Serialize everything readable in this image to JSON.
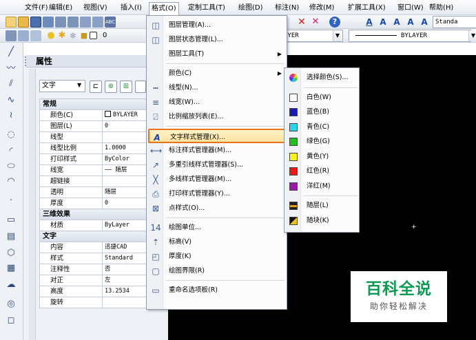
{
  "menubar": [
    "文件(F)",
    "编辑(E)",
    "视图(V)",
    "插入(I)",
    "格式(O)",
    "定制工具(T)",
    "绘图(D)",
    "标注(N)",
    "修改(M)",
    "扩展工具(X)",
    "窗口(W)",
    "帮助(H)"
  ],
  "toolbar": {
    "layer_value": "0",
    "linetype_value": "AYER",
    "lineweight_value": "BYLAYER",
    "textstyle_value": "Standa"
  },
  "properties": {
    "title": "属性",
    "filter_value": "文字",
    "rows": [
      {
        "group": true,
        "label": "常规"
      },
      {
        "label": "颜色(C)",
        "value": "BYLAYER"
      },
      {
        "label": "图层(L)",
        "value": "0"
      },
      {
        "label": "线型",
        "value": ""
      },
      {
        "label": "线型比例",
        "value": "1.0000"
      },
      {
        "label": "打印样式",
        "value": "ByColor"
      },
      {
        "label": "线宽",
        "value": "—— 随层"
      },
      {
        "label": "超链接",
        "value": ""
      },
      {
        "label": "透明",
        "value": "随层"
      },
      {
        "label": "厚度",
        "value": "0"
      },
      {
        "group": true,
        "label": "三维效果"
      },
      {
        "label": "材质",
        "value": "ByLayer"
      },
      {
        "group": true,
        "label": "文字"
      },
      {
        "label": "内容",
        "value": "迅捷CAD"
      },
      {
        "label": "样式",
        "value": "Standard"
      },
      {
        "label": "注释性",
        "value": "否"
      },
      {
        "label": "对正",
        "value": "左"
      },
      {
        "label": "高度",
        "value": "13.2534"
      },
      {
        "label": "旋转",
        "value": ""
      }
    ]
  },
  "format_menu": {
    "items": [
      {
        "label": "图层管理(A)...",
        "icon": "layer-manager-icon"
      },
      {
        "label": "图层状态管理(L)...",
        "icon": "layer-state-icon"
      },
      {
        "label": "图层工具(T)",
        "icon": "",
        "submenu": true
      },
      {
        "sep": true
      },
      {
        "label": "颜色(C)",
        "icon": "",
        "submenu": true
      },
      {
        "label": "线型(N)...",
        "icon": "linetype-icon"
      },
      {
        "label": "线宽(W)...",
        "icon": "lineweight-icon"
      },
      {
        "label": "比例缩放列表(E)...",
        "icon": "scale-list-icon"
      },
      {
        "sep": true
      },
      {
        "label": "文字样式管理(X)...",
        "icon": "text-style-icon",
        "highlight": true
      },
      {
        "label": "标注样式管理器(M)...",
        "icon": "dim-style-icon"
      },
      {
        "label": "多重引线样式管理器(S)...",
        "icon": "mleader-style-icon"
      },
      {
        "label": "多线样式管理器(M)...",
        "icon": "mline-style-icon"
      },
      {
        "label": "打印样式管理器(Y)...",
        "icon": "plot-style-icon"
      },
      {
        "label": "点样式(O)...",
        "icon": "point-style-icon"
      },
      {
        "sep": true
      },
      {
        "label": "绘图单位...",
        "icon": "units-icon"
      },
      {
        "label": "标高(V)",
        "icon": "elevation-icon"
      },
      {
        "label": "厚度(K)",
        "icon": "thickness-icon"
      },
      {
        "label": "绘图界限(R)",
        "icon": "limits-icon"
      },
      {
        "sep": true
      },
      {
        "label": "重命名选项板(R)",
        "icon": "rename-icon"
      }
    ]
  },
  "color_submenu": {
    "items": [
      {
        "label": "选择颜色(S)...",
        "color": "wheel"
      },
      {
        "sep": true
      },
      {
        "label": "白色(W)",
        "color": "#ffffff"
      },
      {
        "label": "蓝色(B)",
        "color": "#1a1ab0"
      },
      {
        "label": "青色(C)",
        "color": "#28d8ea"
      },
      {
        "label": "绿色(G)",
        "color": "#20c020"
      },
      {
        "label": "黄色(Y)",
        "color": "#f5f020"
      },
      {
        "label": "红色(R)",
        "color": "#e81818"
      },
      {
        "label": "洋红(M)",
        "color": "#9a1aa8"
      },
      {
        "sep": true
      },
      {
        "label": "随层(L)",
        "color": "bylayer"
      },
      {
        "label": "随块(K)",
        "color": "byblock"
      }
    ]
  },
  "watermark": {
    "title": "百科全说",
    "subtitle": "助你轻松解决"
  }
}
